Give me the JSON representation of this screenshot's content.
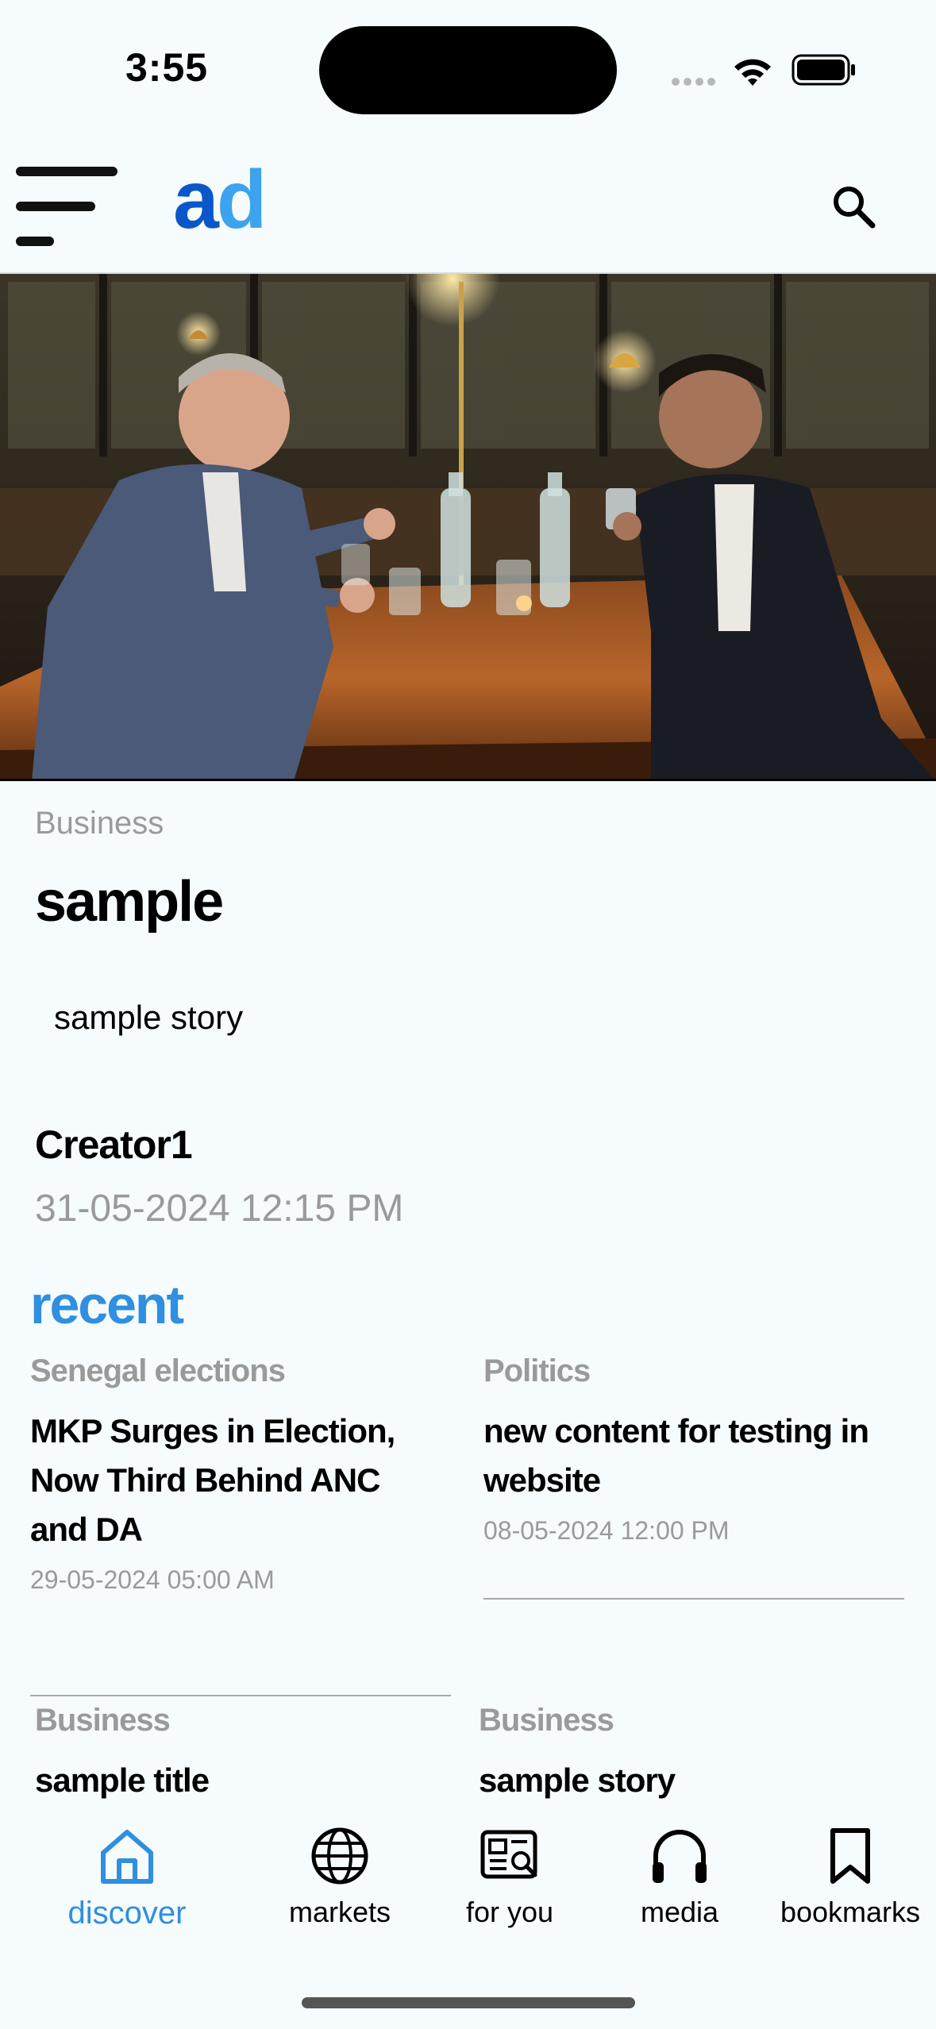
{
  "status_bar": {
    "time": "3:55"
  },
  "header": {
    "logo_first": "a",
    "logo_second": "d"
  },
  "article": {
    "category": "Business",
    "title": "sample",
    "story": "sample story",
    "author": "Creator1",
    "date": "31-05-2024 12:15 PM"
  },
  "recent": {
    "heading": "recent",
    "cards": [
      {
        "category": "Senegal elections",
        "title": "MKP Surges in Election, Now Third Behind ANC and DA",
        "date": "29-05-2024 05:00 AM"
      },
      {
        "category": "Politics",
        "title": "new content for testing in website",
        "date": "08-05-2024 12:00 PM"
      },
      {
        "category": "Business",
        "title": "sample title"
      },
      {
        "category": "Business",
        "title": "sample story"
      }
    ]
  },
  "bottom_nav": {
    "items": [
      {
        "label": "discover",
        "icon": "home-icon",
        "active": true
      },
      {
        "label": "markets",
        "icon": "globe-icon",
        "active": false
      },
      {
        "label": "for you",
        "icon": "news-search-icon",
        "active": false
      },
      {
        "label": "media",
        "icon": "headphones-icon",
        "active": false
      },
      {
        "label": "bookmarks",
        "icon": "bookmark-icon",
        "active": false
      }
    ]
  },
  "colors": {
    "accent": "#2f8fe0",
    "logo_dark": "#0b57c9",
    "logo_light": "#3da3ee",
    "muted": "#9a9a9a",
    "background": "#f6fbfd"
  }
}
